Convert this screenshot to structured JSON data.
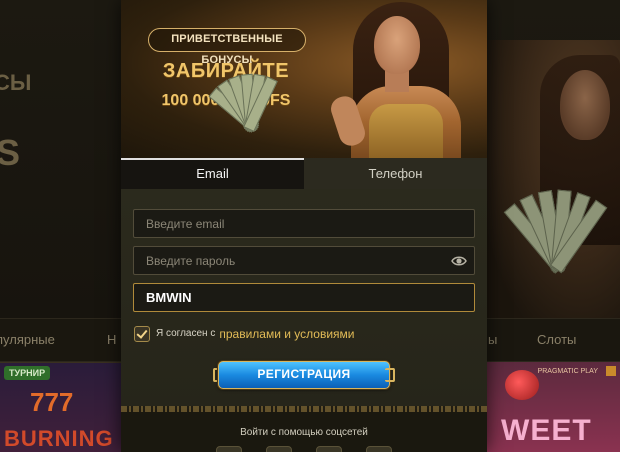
{
  "background": {
    "left_promo_text": "СЫ",
    "left_promo_big": "S",
    "nav": {
      "left_item": "пулярные",
      "left_item2": "Н",
      "right_item1": "ы",
      "right_item2": "Слоты"
    },
    "tile_left": {
      "badge": "ТУРНИР",
      "number": "777",
      "title": "BURNING"
    },
    "tile_right": {
      "title": "WEET",
      "mini": "PRAGMATIC PLAY"
    }
  },
  "banner": {
    "pill": "ПРИВЕТСТВЕННЫЕ БОНУСЫ",
    "title": "ЗАБИРАЙТЕ",
    "subtitle": "100 000₽ +250FS"
  },
  "tabs": [
    {
      "label": "Email",
      "active": true
    },
    {
      "label": "Телефон",
      "active": false
    }
  ],
  "form": {
    "email": {
      "value": "",
      "placeholder": "Введите email"
    },
    "password": {
      "value": "",
      "placeholder": "Введите пароль"
    },
    "promo": {
      "value": "BMWIN",
      "placeholder": ""
    },
    "agree_prefix": "Я согласен с",
    "agree_link": "правилами и условиями",
    "agree_checked": true,
    "submit_label": "РЕГИСТРАЦИЯ"
  },
  "social": {
    "label": "Войти с помощью соцсетей",
    "icons": [
      "social-icon-1",
      "social-icon-2",
      "social-icon-3",
      "social-icon-4"
    ]
  },
  "colors": {
    "accent_gold": "#e3bc57",
    "button_blue": "#1a8ae0",
    "modal_bg": "#1e1b12"
  }
}
